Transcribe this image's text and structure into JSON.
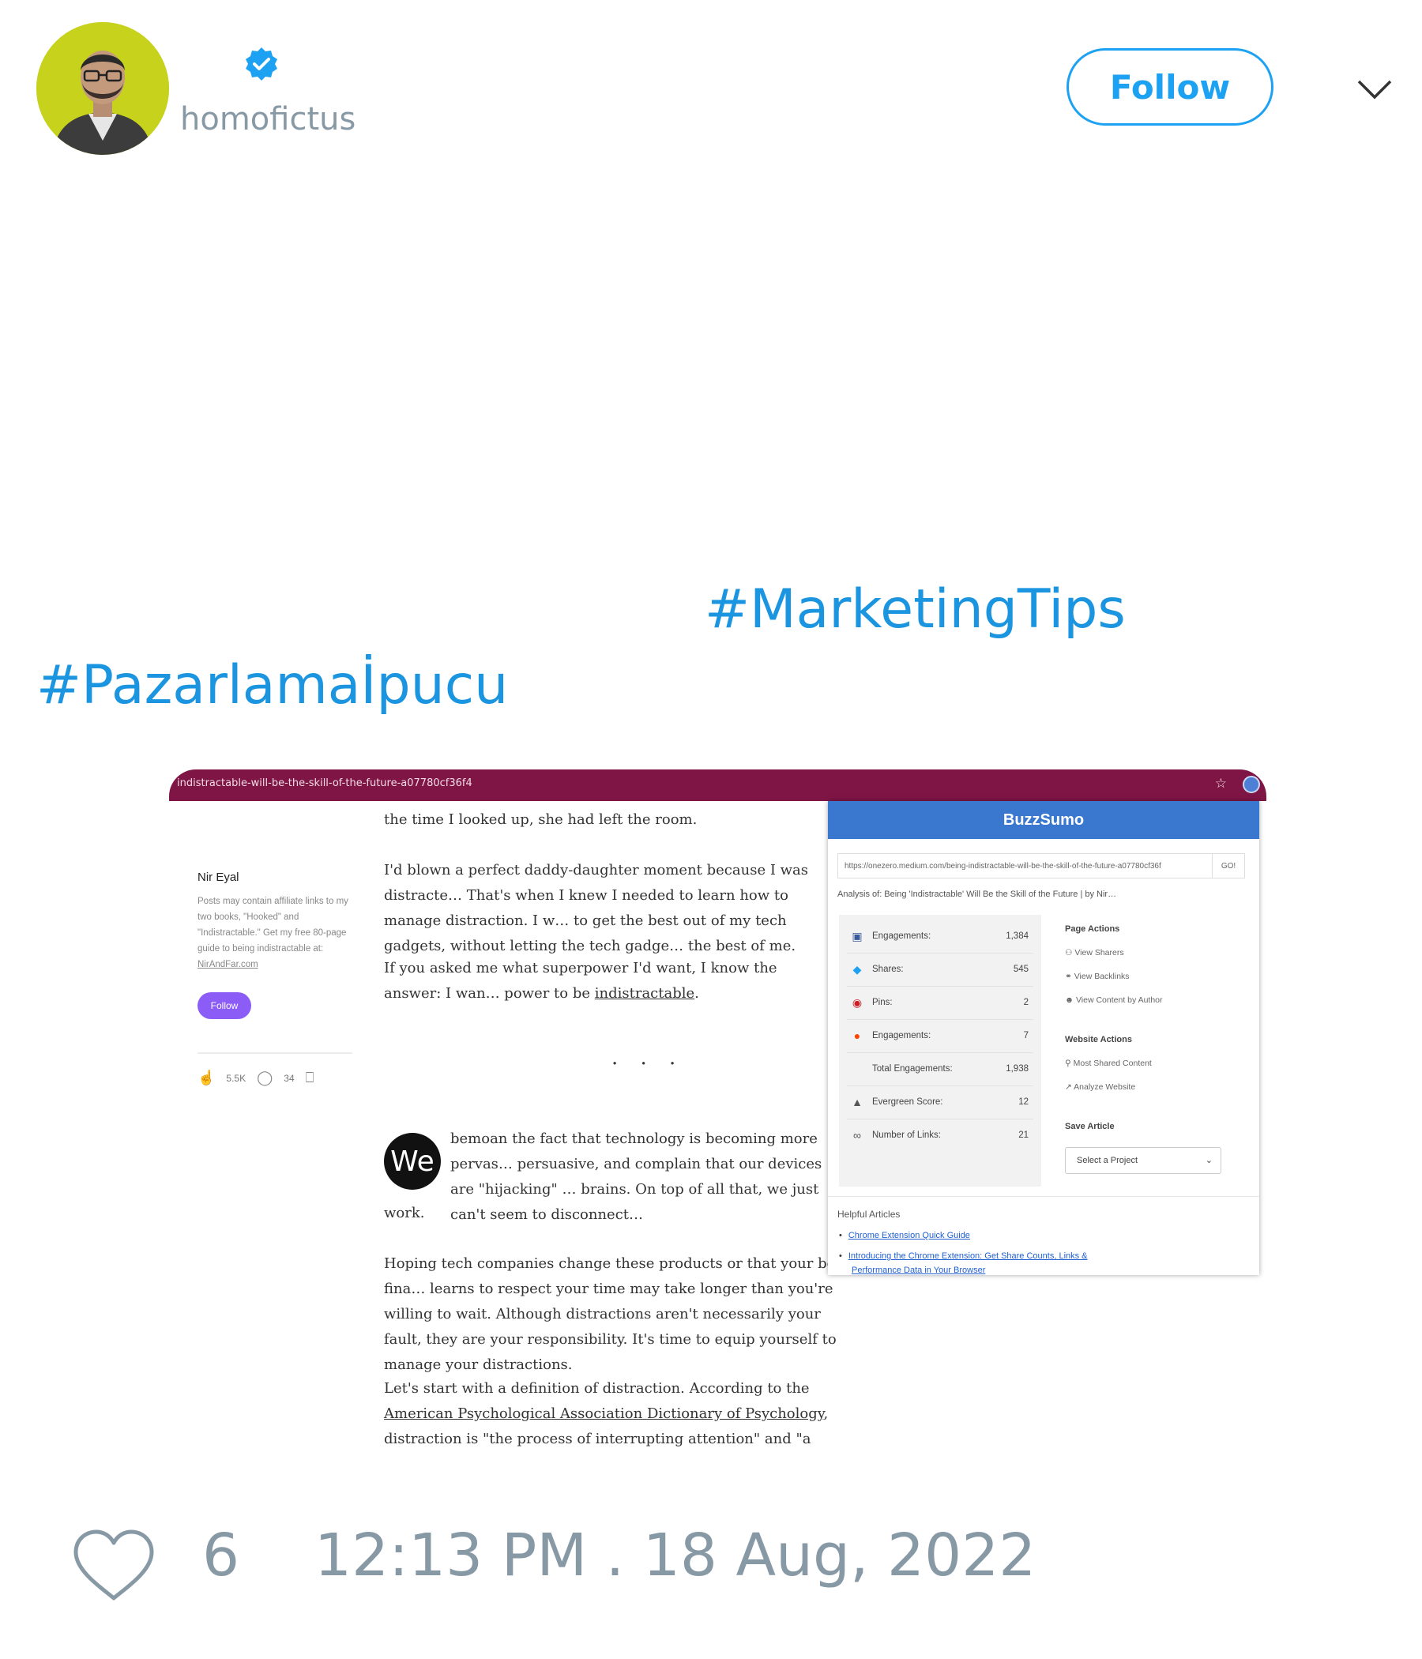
{
  "author": {
    "handle": "homofictus",
    "verified": true
  },
  "header": {
    "follow_label": "Follow"
  },
  "tweet": {
    "hashtags": [
      "#MarketingTips",
      "#Pazarlamaİpucu"
    ]
  },
  "media": {
    "browser_url": "indistractable-will-be-the-skill-of-the-future-a07780cf36f4",
    "article": {
      "p0": "the time I looked up, she had left the room.",
      "p1": "I'd blown a perfect daddy-daughter moment because I was distracte… That's when I knew I needed to learn how to manage distraction. I w… to get the best out of my tech gadgets, without letting the tech gadge… the best of me.",
      "p2_pre": "If you asked me what superpower I'd want, I know the answer: I wan… power to be ",
      "p2_link": "indistractable",
      "p2_post": ".",
      "dots": "· · ·",
      "we_badge": "We",
      "p3a": "bemoan the fact that technology is becoming more pervas… persuasive, and complain that our devices are \"hijacking\" … brains. On top of all that, we just can't seem to disconnect…",
      "p3b": "work.",
      "p4": "Hoping tech companies change these products or that your boss fina… learns to respect your time may take longer than you're willing to wait. Although distractions aren't necessarily your fault, they are your responsibility. It's time to equip yourself to manage your distractions.",
      "p5_pre": "Let's start with a definition of distraction. According to the ",
      "p5_link": "American Psychological Association Dictionary of Psychology",
      "p5_post": ", distraction is \"the process of interrupting attention\" and \"a stimulus or task that draws"
    },
    "sidebar": {
      "name": "Nir Eyal",
      "bio": "Posts may contain affiliate links to my two books, \"Hooked\" and \"Indistractable.\" Get my free 80-page guide to being indistractable at:",
      "bio_link": "NirAndFar.com",
      "follow_label": "Follow",
      "claps": "5.5K",
      "responses": "34"
    },
    "buzzsumo": {
      "brand": "BuzzSumo",
      "url": "https://onezero.medium.com/being-indistractable-will-be-the-skill-of-the-future-a07780cf36f",
      "go_label": "GO!",
      "analysis": "Analysis of: Being 'Indistractable' Will Be the Skill of the Future | by Nir…",
      "stats": [
        {
          "icon": "facebook-icon",
          "label": "Engagements:",
          "value": "1,384"
        },
        {
          "icon": "twitter-icon",
          "label": "Shares:",
          "value": "545"
        },
        {
          "icon": "pinterest-icon",
          "label": "Pins:",
          "value": "2"
        },
        {
          "icon": "reddit-icon",
          "label": "Engagements:",
          "value": "7"
        },
        {
          "icon": "",
          "label": "Total Engagements:",
          "value": "1,938"
        },
        {
          "icon": "tree-icon",
          "label": "Evergreen Score:",
          "value": "12"
        },
        {
          "icon": "link-icon",
          "label": "Number of Links:",
          "value": "21"
        }
      ],
      "page_actions_title": "Page Actions",
      "page_actions": [
        "View Sharers",
        "View Backlinks",
        "View Content by Author"
      ],
      "website_actions_title": "Website Actions",
      "website_actions": [
        "Most Shared Content",
        "Analyze Website"
      ],
      "save_title": "Save Article",
      "select_placeholder": "Select a Project",
      "help_title": "Helpful Articles",
      "help_links": [
        "Chrome Extension Quick Guide",
        "Introducing the Chrome Extension: Get Share Counts, Links &",
        "Performance Data in Your Browser"
      ]
    }
  },
  "footer": {
    "likes": "6",
    "timestamp": "12:13 PM . 18 Aug, 2022"
  },
  "colors": {
    "accent": "#1da1f2",
    "hashtag": "#1b95e0",
    "muted": "#8899a6",
    "browser_bar": "#7f1545",
    "buzzsumo_blue": "#3a78cf"
  }
}
